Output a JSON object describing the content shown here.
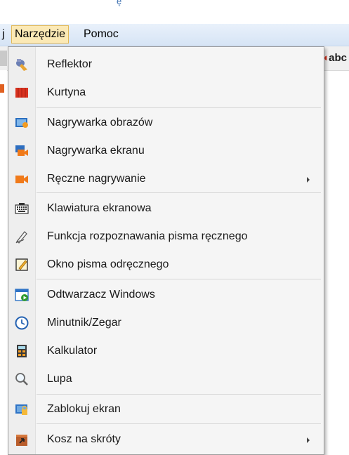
{
  "menubar": {
    "first_label": "j",
    "narzedzie_label": "Narzędzie",
    "pomoc_label": "Pomoc"
  },
  "toolbar": {
    "abc_label": "abc"
  },
  "top_glyph": "ę",
  "menu": {
    "items": [
      {
        "label": "Reflektor",
        "icon": "spotlight-icon",
        "submenu": false
      },
      {
        "label": "Kurtyna",
        "icon": "curtain-icon",
        "submenu": false
      },
      {
        "label": "Nagrywarka obrazów",
        "icon": "image-recorder-icon",
        "submenu": false
      },
      {
        "label": "Nagrywarka ekranu",
        "icon": "screen-recorder-icon",
        "submenu": false
      },
      {
        "label": "Ręczne nagrywanie",
        "icon": "manual-record-icon",
        "submenu": true
      },
      {
        "label": "Klawiatura ekranowa",
        "icon": "keyboard-icon",
        "submenu": false
      },
      {
        "label": "Funkcja rozpoznawania pisma ręcznego",
        "icon": "handwriting-recognition-icon",
        "submenu": false
      },
      {
        "label": "Okno pisma odręcznego",
        "icon": "handwriting-window-icon",
        "submenu": false
      },
      {
        "label": "Odtwarzacz Windows",
        "icon": "media-player-icon",
        "submenu": false
      },
      {
        "label": "Minutnik/Zegar",
        "icon": "clock-icon",
        "submenu": false
      },
      {
        "label": "Kalkulator",
        "icon": "calculator-icon",
        "submenu": false
      },
      {
        "label": "Lupa",
        "icon": "magnifier-icon",
        "submenu": false
      },
      {
        "label": "Zablokuj ekran",
        "icon": "lock-screen-icon",
        "submenu": false
      },
      {
        "label": "Kosz na skróty",
        "icon": "shortcut-bin-icon",
        "submenu": true
      }
    ]
  },
  "colors": {
    "menubar_active_bg": "#fbe9b5",
    "menubar_active_border": "#e2b857",
    "menu_bg": "#f5f5f5"
  }
}
